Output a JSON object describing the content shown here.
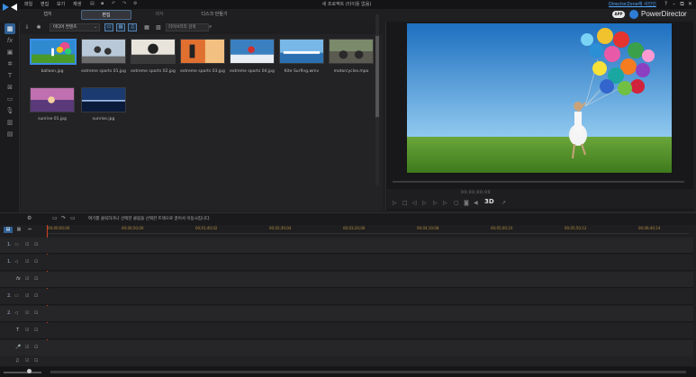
{
  "titlebar": {
    "menu": [
      "파일",
      "편집",
      "보기",
      "재생"
    ],
    "project_title": "새 프로젝트 (타이틀 없음)",
    "directorzone_link": "DirectorZone에 사인인",
    "window_buttons": [
      "?",
      "–",
      "⧉",
      "✕"
    ]
  },
  "brand": {
    "badge": "APP",
    "name": "PowerDirector"
  },
  "mode_tabs": [
    "캡처",
    "편집",
    "제작",
    "디스크 만들기"
  ],
  "library": {
    "media_filter": "미디어 컨텐츠",
    "search_placeholder": "라이브러리 검색",
    "items": [
      {
        "name": "balloon.jpg"
      },
      {
        "name": "extreme sports 01.jpg"
      },
      {
        "name": "extreme sports 02.jpg"
      },
      {
        "name": "extreme sports 03.jpg"
      },
      {
        "name": "extreme sports 04.jpg"
      },
      {
        "name": "Kite Surfing.wmv"
      },
      {
        "name": "motorcycles.mpo"
      },
      {
        "name": "sunrise 01.jpg"
      },
      {
        "name": "sunrise.jpg"
      }
    ]
  },
  "preview": {
    "timecode": "00;00;00;00",
    "fps": "3D"
  },
  "timeline": {
    "hint": "여기를 클릭하거나 선택한 클립을 선택한 트랙으로 끌어서 이동시킵니다.",
    "ruler": [
      "00;00;00;00",
      "00;00;50;00",
      "00;01;40;02",
      "00;02;30;04",
      "00;03;20;06",
      "00;04;10;08",
      "00;05;00;10",
      "00;05;50;12",
      "00;06;40;14"
    ],
    "tracks": [
      {
        "label": "1."
      },
      {
        "label": "1."
      },
      {
        "label": "fx"
      },
      {
        "label": "2."
      },
      {
        "label": "2."
      },
      {
        "label": "T"
      },
      {
        "label": "🎤"
      },
      {
        "label": "♫"
      }
    ]
  },
  "colors": {
    "accent": "#3a8ee6",
    "brand_blue": "#2e7cd6",
    "link": "#4fa8ff"
  }
}
